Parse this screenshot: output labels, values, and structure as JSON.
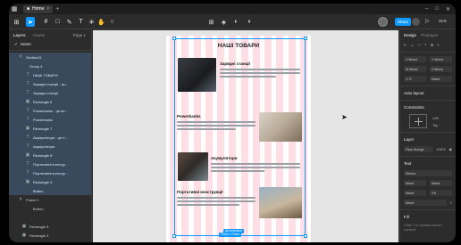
{
  "titlebar": {
    "tab_label": "Home",
    "tab_close": "×",
    "new_tab": "+"
  },
  "toolbar": {
    "share_label": "Share",
    "play": "▷",
    "zoom": "31%"
  },
  "left_panel": {
    "tabs": [
      "Layers",
      "Assets"
    ],
    "page_selector": "Page 1",
    "page_name": "Home",
    "layers": [
      {
        "icon": "#",
        "label": "Section01",
        "indent": 10,
        "selected": true
      },
      {
        "icon": "",
        "label": "Group 4",
        "indent": 14,
        "selected": true
      },
      {
        "icon": "T",
        "label": "НАШІ ТОВАРИ",
        "indent": 18,
        "selected": true
      },
      {
        "icon": "T",
        "label": "Зарядні станції - за...",
        "indent": 18,
        "selected": true
      },
      {
        "icon": "T",
        "label": "Зарядні станції",
        "indent": 18,
        "selected": true
      },
      {
        "icon": "▣",
        "label": "Rectangle 6",
        "indent": 18,
        "selected": true
      },
      {
        "icon": "T",
        "label": "Powerbanks - це пе...",
        "indent": 18,
        "selected": true
      },
      {
        "icon": "T",
        "label": "Powerbanks",
        "indent": 18,
        "selected": true
      },
      {
        "icon": "▣",
        "label": "Rectangle 7",
        "indent": 18,
        "selected": true
      },
      {
        "icon": "T",
        "label": "Акумулятори - це п...",
        "indent": 18,
        "selected": true
      },
      {
        "icon": "T",
        "label": "Акумулятори",
        "indent": 18,
        "selected": true
      },
      {
        "icon": "▣",
        "label": "Rectangle 8",
        "indent": 18,
        "selected": true
      },
      {
        "icon": "T",
        "label": "Портативні констру...",
        "indent": 18,
        "selected": true
      },
      {
        "icon": "T",
        "label": "Портативні констру...",
        "indent": 18,
        "selected": true
      },
      {
        "icon": "▣",
        "label": "Rectangle 9",
        "indent": 18,
        "selected": true
      },
      {
        "icon": "",
        "label": "Button",
        "indent": 18,
        "selected": true
      },
      {
        "icon": "#",
        "label": "Frame 1",
        "indent": 10,
        "selected": false
      },
      {
        "icon": "",
        "label": "Button",
        "indent": 18,
        "selected": false
      },
      {
        "icon": "",
        "label": "",
        "indent": 18,
        "selected": false
      },
      {
        "icon": "▣",
        "label": "Rectangle 5",
        "indent": 14,
        "selected": false
      },
      {
        "icon": "▣",
        "label": "Rectangle 4",
        "indent": 14,
        "selected": false
      }
    ]
  },
  "canvas": {
    "title": "НАШІ ТОВАРИ",
    "sections": [
      {
        "heading": "Зарядні станції"
      },
      {
        "heading": "Powerbanks"
      },
      {
        "heading": "Акумулятори"
      },
      {
        "heading": "Портативні конструкції"
      }
    ],
    "button_label": "Детальніше",
    "size_label": "Fixed × Fixed"
  },
  "right_panel": {
    "tabs": [
      "Design",
      "Prototype"
    ],
    "w_label": "W",
    "w_value": "Mixed",
    "h_label": "H",
    "h_value": "Mixed",
    "x_label": "X",
    "x_value": "Mixed",
    "y_label": "Y",
    "y_value": "Mixed",
    "r_label": "↺",
    "r_value": "0°",
    "c_value": "Mixed",
    "auto_layout": "Auto layout",
    "constraints": "Constraints",
    "left_label": "Left",
    "top_label": "Top",
    "layer": "Layer",
    "blend": "Pass through",
    "opacity": "100%",
    "text": "Text",
    "font": "Ebrima",
    "weight": "Mixed",
    "size": "Mixed",
    "line_height": "Mixed",
    "letter_spacing": "0%",
    "para": "Mixed",
    "fill": "Fill",
    "fill_note": "Click + to replace mixed content"
  }
}
